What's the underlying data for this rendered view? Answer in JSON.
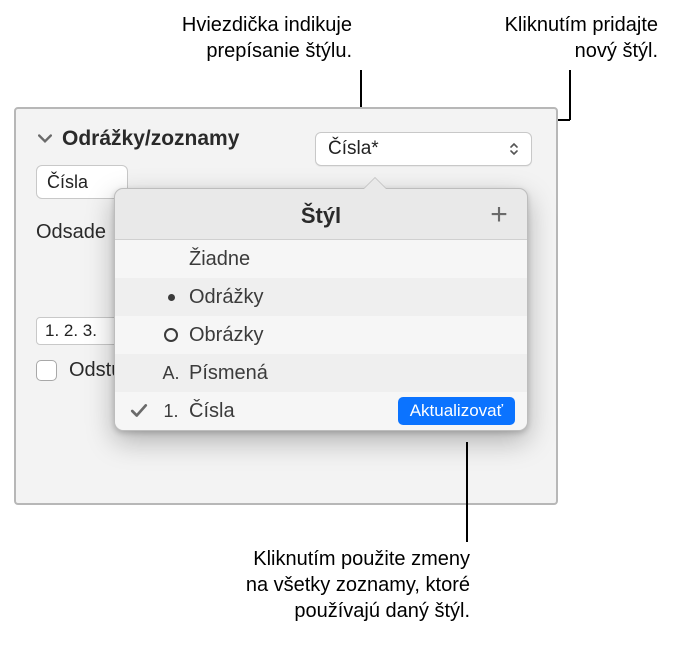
{
  "callouts": {
    "asterisk": [
      "Hviezdička indikuje",
      "prepísanie štýlu."
    ],
    "add": [
      "Kliknutím pridajte",
      "nový štýl."
    ],
    "update": [
      "Kliknutím použite zmeny",
      "na všetky zoznamy, ktoré",
      "používajú daný štýl."
    ]
  },
  "panel": {
    "section_title": "Odrážky/zoznamy",
    "style_value": "Čísla*",
    "sub_value": "Čísla",
    "indent_label": "Odsade",
    "letter": "Č",
    "number_field": "1. 2. 3.",
    "checkbox_label": "Odstupňované čísla"
  },
  "popover": {
    "title": "Štýl",
    "items": [
      {
        "marker": "none",
        "label": "Žiadne",
        "checked": false
      },
      {
        "marker": "dot",
        "label": "Odrážky",
        "checked": false
      },
      {
        "marker": "ring",
        "label": "Obrázky",
        "checked": false
      },
      {
        "marker": "A.",
        "label": "Písmená",
        "checked": false
      },
      {
        "marker": "1.",
        "label": "Čísla",
        "checked": true,
        "update": true
      }
    ],
    "update_label": "Aktualizovať"
  }
}
